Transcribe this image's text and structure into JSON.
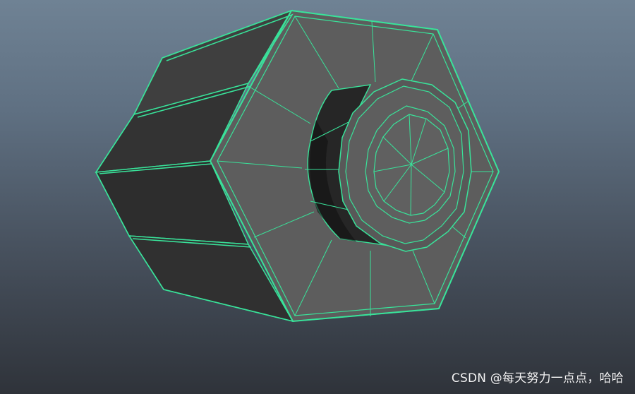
{
  "viewport": {
    "background_top": "#6f8294",
    "background_bottom": "#2f333a",
    "wire_color": "#39e39a",
    "face_color_front": "#5b5b5b",
    "face_color_side": "#3c3c3c",
    "hole_color": "#202020"
  },
  "watermark": {
    "text": "CSDN @每天努力一点点，哈哈"
  }
}
